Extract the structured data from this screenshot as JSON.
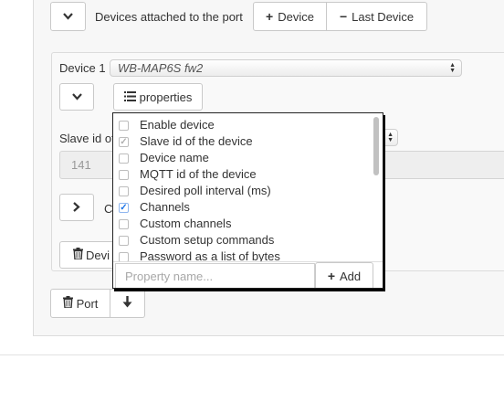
{
  "port": {
    "devices_label": "Devices attached to the port",
    "add_device": "Device",
    "remove_last_device": "Last Device",
    "delete_port": "Port"
  },
  "device": {
    "label": "Device 1",
    "selected_type": "WB-MAP6S fw2",
    "properties_button": "properties",
    "slave_id_label": "Slave id of",
    "slave_id_value": "141",
    "collapsed_section_label": "C",
    "delete_device_label": "Devi"
  },
  "properties_menu": {
    "items": [
      {
        "label": "Enable device",
        "state": "unchecked"
      },
      {
        "label": "Slave id of the device",
        "state": "checked-disabled"
      },
      {
        "label": "Device name",
        "state": "unchecked"
      },
      {
        "label": "MQTT id of the device",
        "state": "unchecked"
      },
      {
        "label": "Desired poll interval (ms)",
        "state": "unchecked"
      },
      {
        "label": "Channels",
        "state": "checked"
      },
      {
        "label": "Custom channels",
        "state": "unchecked"
      },
      {
        "label": "Custom setup commands",
        "state": "unchecked"
      },
      {
        "label": "Password as a list of bytes",
        "state": "unchecked"
      }
    ],
    "input_placeholder": "Property name...",
    "add_button": "Add"
  },
  "icons": {
    "collapse": "chevron-down-icon",
    "expand": "chevron-right-icon",
    "list": "list-icon",
    "trash": "trash-icon",
    "move_down": "arrow-down-icon",
    "plus": "plus-icon",
    "minus": "minus-icon"
  },
  "colors": {
    "checkbox_checked": "#1a73e8",
    "panel_background": "#f7f7f7"
  }
}
